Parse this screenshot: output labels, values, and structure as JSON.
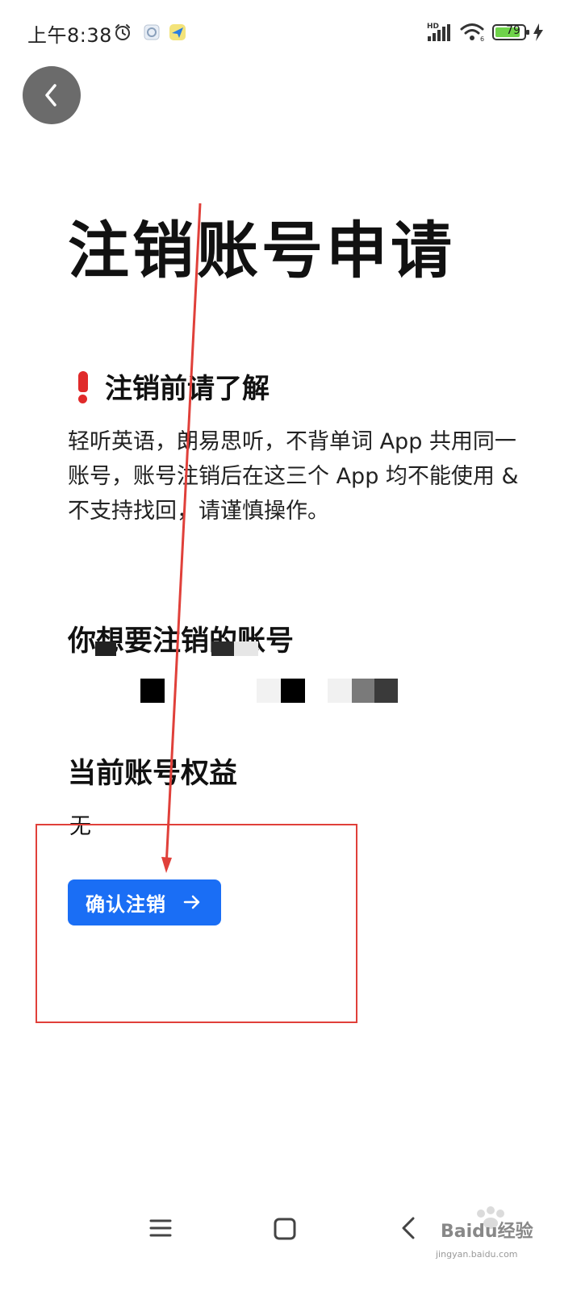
{
  "status_bar": {
    "time": "上午8:38",
    "network_label": "HD",
    "battery_level": "79",
    "icons": [
      "alarm-icon",
      "notification-icon",
      "app-notification-icon",
      "signal-icon",
      "wifi-icon",
      "battery-icon",
      "charging-icon"
    ]
  },
  "page": {
    "title": "注销账号申请",
    "notice_heading": "注销前请了解",
    "notice_body": "轻听英语，朗易思听，不背单词 App 共用同一账号，账号注销后在这三个 App 均不能使用 & 不支持找回，请谨慎操作。",
    "account_heading": "你想要注销的账号",
    "benefits_heading": "当前账号权益",
    "benefits_value": "无",
    "confirm_button_label": "确认注销"
  },
  "colors": {
    "primary": "#1a6ef5",
    "back_button": "#6b6b6b",
    "annotation": "#e0403a",
    "warning": "#e02a2a"
  },
  "watermark": {
    "text": "Baidu经验",
    "sub": "jingyan.baidu.com"
  }
}
